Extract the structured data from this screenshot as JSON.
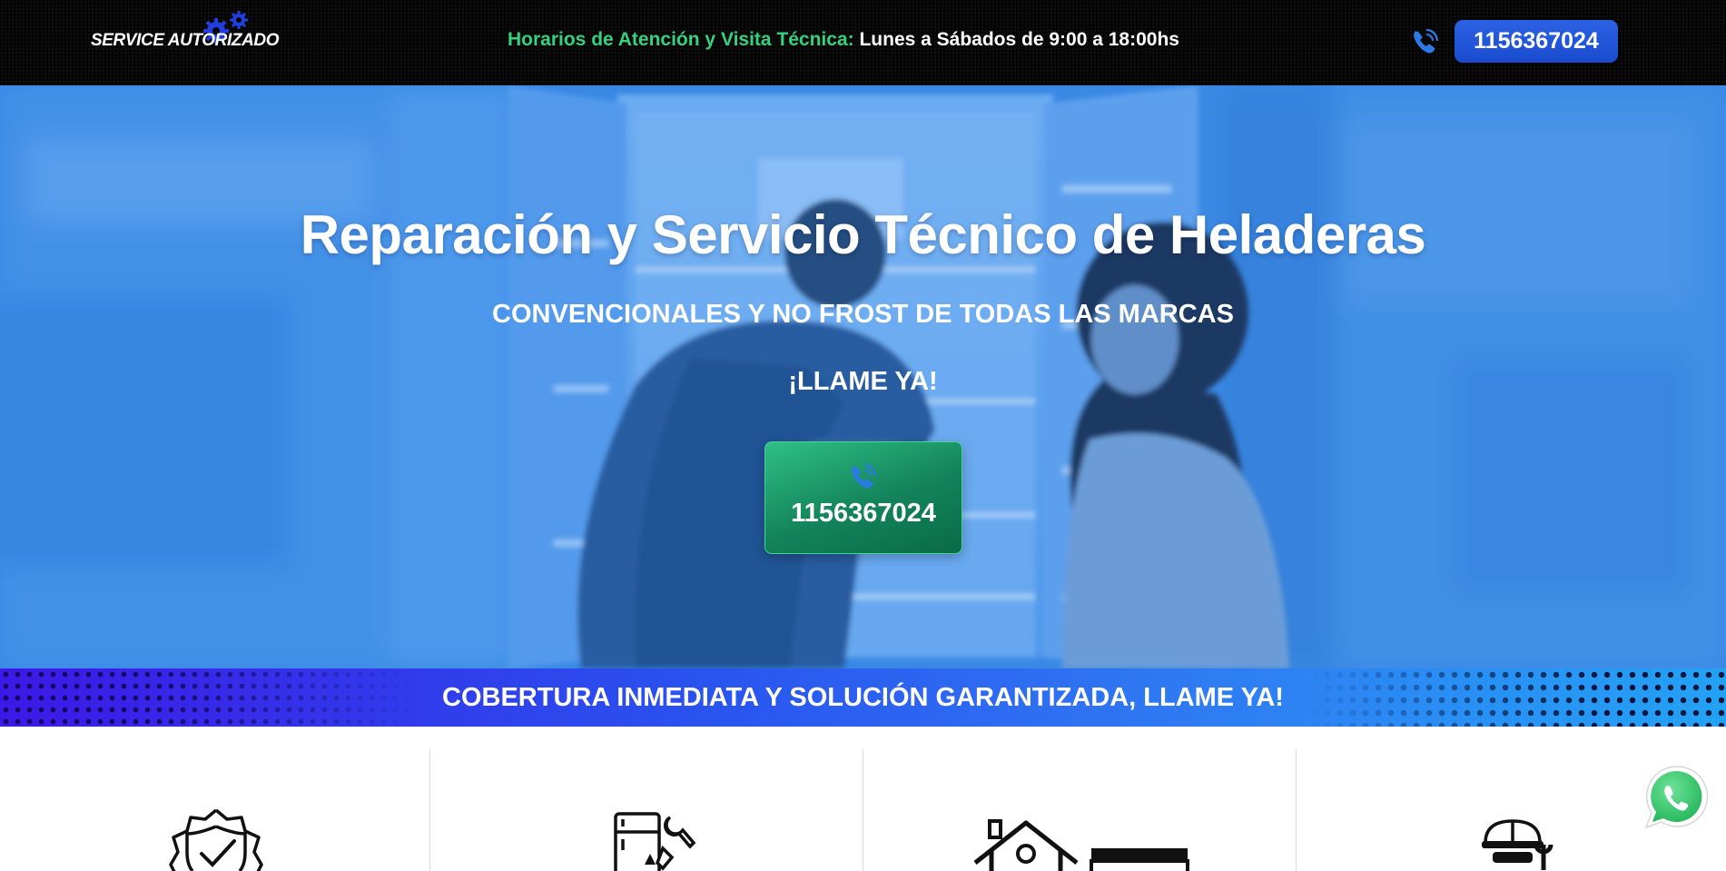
{
  "header": {
    "logo_text": "SERVICE AUTORIZADO",
    "hours_label": "Horarios de Atención y Visita Técnica:",
    "hours_value": "Lunes a Sábados de 9:00 a 18:00hs",
    "phone": "1156367024"
  },
  "hero": {
    "title": "Reparación y Servicio Técnico de Heladeras",
    "subtitle": "CONVENCIONALES Y NO FROST DE TODAS LAS MARCAS",
    "cta_label": "¡LLAME YA!",
    "phone": "1156367024"
  },
  "strip": {
    "text": "COBERTURA INMEDIATA Y SOLUCIÓN GARANTIZADA, LLAME YA!"
  },
  "features": {
    "icons": [
      "shield-check-icon",
      "fridge-tools-icon",
      "house-truck-icon",
      "technician-icon"
    ]
  },
  "icons": {
    "logo": "gears-icon",
    "top_phone": "phone-ringing-icon",
    "hero_phone": "phone-ringing-icon",
    "whatsapp": "whatsapp-icon"
  },
  "colors": {
    "topbar_bg": "#050505",
    "hours_label": "#36d17e",
    "phone_button": "#1f55d8",
    "hero_tint": "#3f91e8",
    "hero_button": "#13835a",
    "strip_start": "#3c19e6",
    "strip_end": "#23a2f4",
    "whatsapp": "#25d366"
  }
}
